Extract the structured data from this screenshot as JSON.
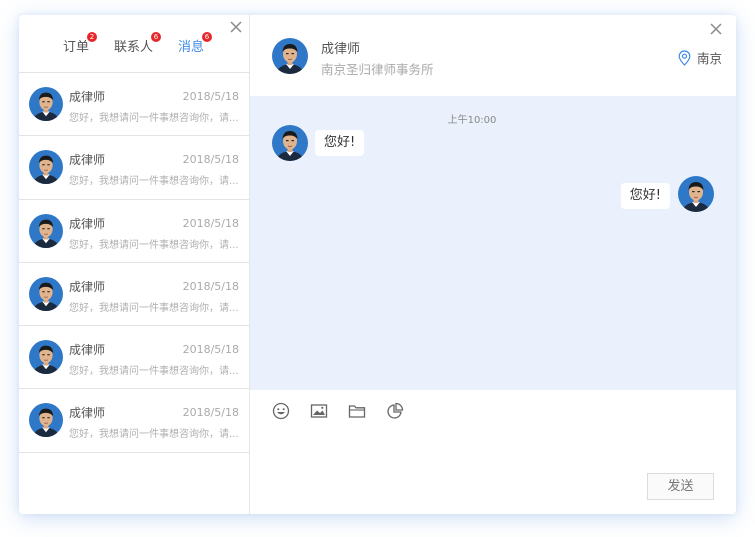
{
  "tabs": [
    {
      "label": "订单",
      "badge": "2"
    },
    {
      "label": "联系人",
      "badge": "6"
    },
    {
      "label": "消息",
      "badge": "6"
    }
  ],
  "conversations": [
    {
      "name": "成律师",
      "date": "2018/5/18",
      "preview": "您好，我想请问一件事想咨询你，请..."
    },
    {
      "name": "成律师",
      "date": "2018/5/18",
      "preview": "您好，我想请问一件事想咨询你，请..."
    },
    {
      "name": "成律师",
      "date": "2018/5/18",
      "preview": "您好，我想请问一件事想咨询你，请..."
    },
    {
      "name": "成律师",
      "date": "2018/5/18",
      "preview": "您好，我想请问一件事想咨询你，请..."
    },
    {
      "name": "成律师",
      "date": "2018/5/18",
      "preview": "您好，我想请问一件事想咨询你，请..."
    },
    {
      "name": "成律师",
      "date": "2018/5/18",
      "preview": "您好，我想请问一件事想咨询你，请..."
    }
  ],
  "contact": {
    "name": "成律师",
    "firm": "南京圣归律师事务所",
    "location": "南京"
  },
  "chat": {
    "timestamp": "上午10:00",
    "messages": [
      {
        "from": "them",
        "text": "您好!"
      },
      {
        "from": "me",
        "text": "您好!"
      }
    ]
  },
  "toolbar": {
    "icons": [
      "emoji-icon",
      "image-icon",
      "folder-icon",
      "pie-chart-icon"
    ]
  },
  "send_label": "发送",
  "colors": {
    "accent": "#3d8ae6",
    "chat_bg": "#eaf1fd",
    "badge": "#e8262a"
  }
}
